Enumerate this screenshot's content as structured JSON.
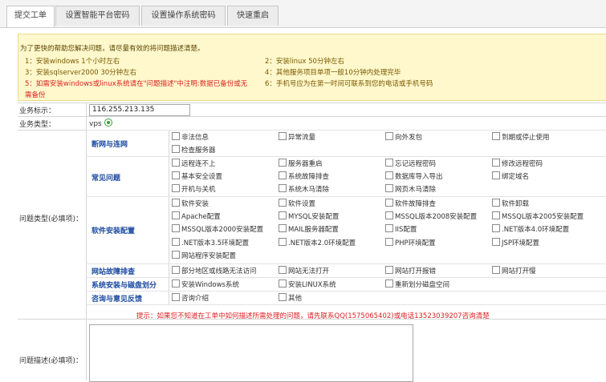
{
  "tabs": [
    "提交工单",
    "设置智能平台密码",
    "设置操作系统密码",
    "快速重启"
  ],
  "notice": {
    "intro": "为了更快的帮助您解决问题，请尽量有效的将问题描述清楚。",
    "left": [
      "1：安装windows 1个小时左右",
      "3：安装sqlserver2000 30分钟左右",
      "5：如需安装windows或linux系统请在\"问题描述\"中注明:数据已备份或无",
      "需备份"
    ],
    "right": [
      "2：安装linux 50分钟左右",
      "4：其他服务项目单项一般10分钟内处理完毕",
      "6：手机号应为在第一时间可联系到您的电话或手机号码"
    ]
  },
  "form": {
    "biz_id_label": "业务标示：",
    "biz_id_value": "116.255.213.135",
    "biz_type_label": "业务类型：",
    "biz_type_value": "vps",
    "problem_type_label": "问题类型(必填项)：",
    "desc_label": "问题描述(必填项)：",
    "tip": "提示：如果您不知道在工单中如何描述所需处理的问题，请先联系QQ(1575065402)或电话13523039207咨询清楚"
  },
  "categories": [
    {
      "name": "断网与连网",
      "options": [
        "非法信息",
        "异常流量",
        "向外发包",
        "到期或停止使用",
        "检查服务器"
      ]
    },
    {
      "name": "常见问题",
      "options": [
        "远程连不上",
        "服务器重启",
        "忘记远程密码",
        "修改远程密码",
        "基本安全设置",
        "系统故障排查",
        "数据库导入导出",
        "绑定域名",
        "开机与关机",
        "系统木马清除",
        "网页木马清除"
      ]
    },
    {
      "name": "软件安装配置",
      "options": [
        "软件安装",
        "软件设置",
        "软件故障排查",
        "软件卸载",
        "Apache配置",
        "MYSQL安装配置",
        "MSSQL版本2008安装配置",
        "MSSQL版本2005安装配置",
        "MSSQL版本2000安装配置",
        "MAIL服务器配置",
        "IIS配置",
        ".NET版本4.0环境配置",
        ".NET版本3.5环境配置",
        ".NET版本2.0环境配置",
        "PHP环境配置",
        "JSP环境配置",
        "网站程序安装配置"
      ]
    },
    {
      "name": "网站故障排查",
      "options": [
        "部分地区或线路无法访问",
        "网站无法打开",
        "网站打开报错",
        "网站打开慢"
      ]
    },
    {
      "name": "系统安装与磁盘划分",
      "options": [
        "安装Windows系统",
        "安装LINUX系统",
        "重新划分磁盘空间"
      ]
    },
    {
      "name": "咨询与意见反馈",
      "options": [
        "咨询介绍",
        "其他"
      ]
    }
  ]
}
